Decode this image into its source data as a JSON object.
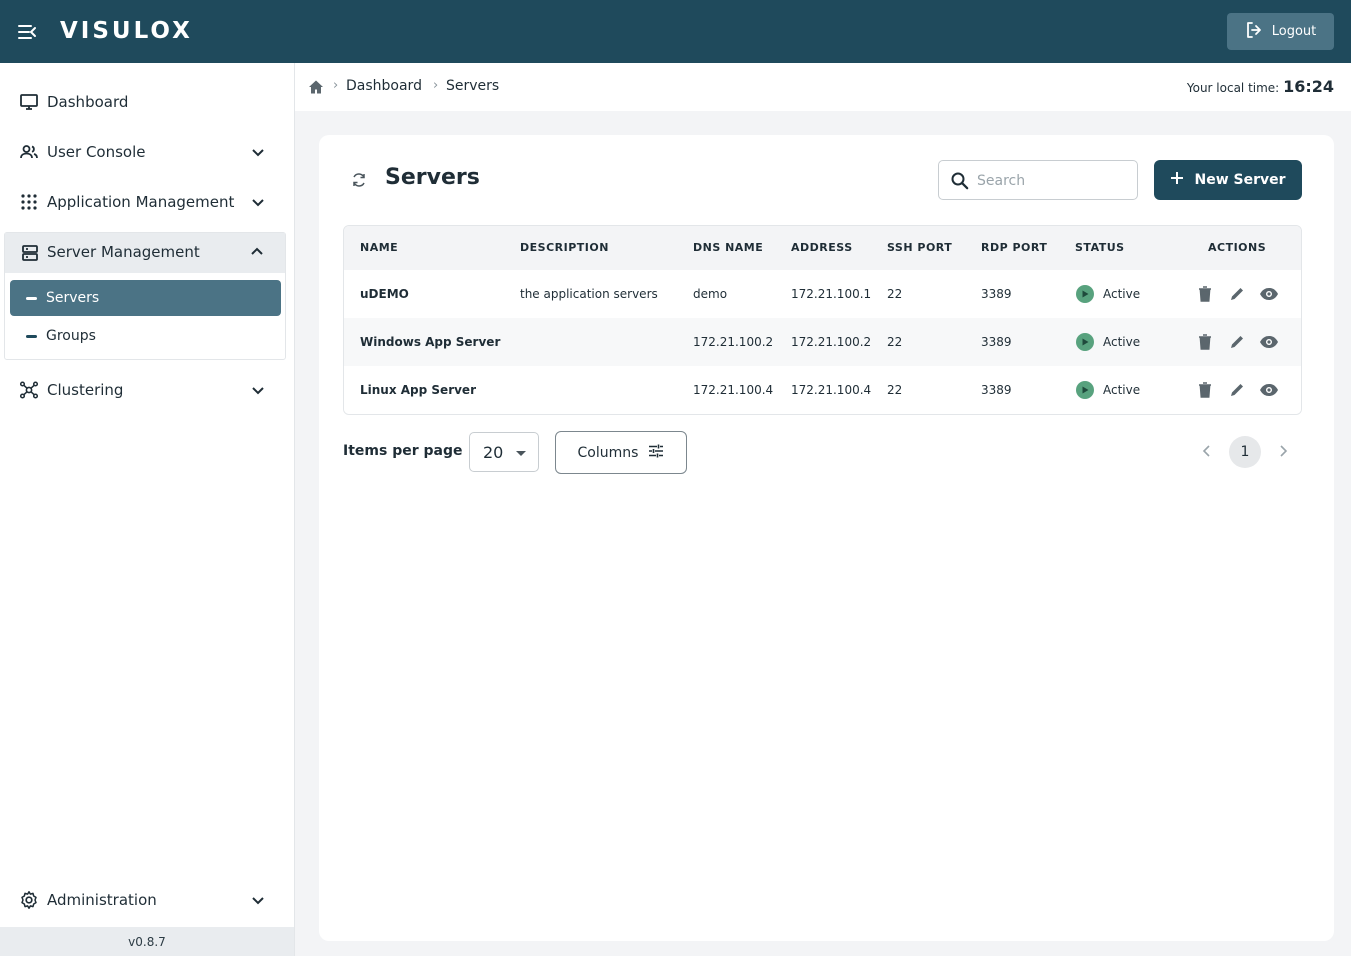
{
  "header": {
    "brand": "VISULOX",
    "logout_label": "Logout",
    "icons": {
      "menu": "menu-collapse-icon",
      "logout": "logout-icon"
    }
  },
  "sidebar": {
    "items": [
      {
        "label": "Dashboard",
        "icon": "monitor-icon"
      },
      {
        "label": "User Console",
        "icon": "users-icon"
      },
      {
        "label": "Application Management",
        "icon": "apps-grid-icon"
      },
      {
        "label": "Server Management",
        "icon": "server-icon",
        "expanded": true,
        "children": [
          {
            "label": "Servers",
            "active": true
          },
          {
            "label": "Groups",
            "active": false
          }
        ]
      },
      {
        "label": "Clustering",
        "icon": "cluster-icon"
      },
      {
        "label": "Administration",
        "icon": "gear-icon"
      }
    ],
    "version": "v0.8.7"
  },
  "breadcrumb": {
    "items": [
      "Dashboard",
      "Servers"
    ],
    "local_time_label": "Your local time:",
    "local_time_value": "16:24"
  },
  "page": {
    "title": "Servers",
    "search_placeholder": "Search",
    "new_button_label": "New Server"
  },
  "table": {
    "columns": [
      "NAME",
      "DESCRIPTION",
      "DNS NAME",
      "ADDRESS",
      "SSH PORT",
      "RDP PORT",
      "STATUS",
      "ACTIONS"
    ],
    "rows": [
      {
        "name": "uDEMO",
        "description": "the application servers",
        "dns": "demo",
        "address": "172.21.100.1",
        "ssh": "22",
        "rdp": "3389",
        "status": "Active"
      },
      {
        "name": "Windows App Server",
        "description": "",
        "dns": "172.21.100.2",
        "address": "172.21.100.2",
        "ssh": "22",
        "rdp": "3389",
        "status": "Active"
      },
      {
        "name": "Linux App Server",
        "description": "",
        "dns": "172.21.100.4",
        "address": "172.21.100.4",
        "ssh": "22",
        "rdp": "3389",
        "status": "Active"
      }
    ]
  },
  "footer": {
    "items_per_page_label": "Items per page",
    "items_per_page_value": "20",
    "columns_label": "Columns",
    "current_page": "1"
  },
  "colors": {
    "primary": "#1f4a5c",
    "active_nav": "#4b7385",
    "status_active": "#58a27e"
  }
}
